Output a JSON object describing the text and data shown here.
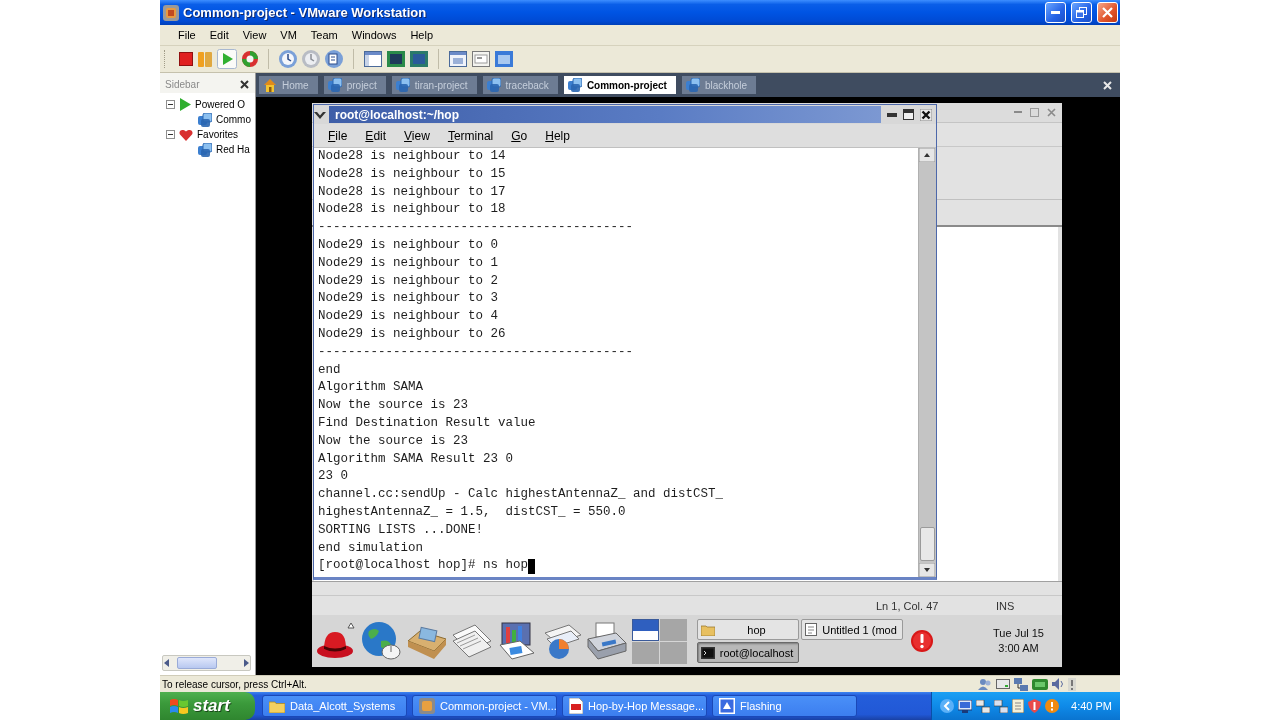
{
  "window": {
    "title": "Common-project - VMware Workstation"
  },
  "menu": [
    "File",
    "Edit",
    "View",
    "VM",
    "Team",
    "Windows",
    "Help"
  ],
  "sidebar": {
    "title": "Sidebar",
    "items": [
      {
        "label": "Powered O",
        "kind": "running",
        "expanded": true,
        "children": [
          {
            "label": "Commo",
            "kind": "vm"
          }
        ]
      },
      {
        "label": "Favorites",
        "kind": "favorites",
        "expanded": true,
        "children": [
          {
            "label": "Red Ha",
            "kind": "vm"
          }
        ]
      }
    ]
  },
  "tabs": [
    {
      "label": "Home",
      "kind": "home",
      "selected": false
    },
    {
      "label": "project",
      "kind": "vm",
      "selected": false
    },
    {
      "label": "tiran-project",
      "kind": "vm",
      "selected": false
    },
    {
      "label": "traceback",
      "kind": "vm",
      "selected": false
    },
    {
      "label": "Common-project",
      "kind": "vm",
      "selected": true
    },
    {
      "label": "blackhole",
      "kind": "vm",
      "selected": false
    }
  ],
  "guest": {
    "terminal": {
      "title": "root@localhost:~/hop",
      "menu": [
        "File",
        "Edit",
        "View",
        "Terminal",
        "Go",
        "Help"
      ],
      "lines": [
        "Node28 is neighbour to 14",
        "Node28 is neighbour to 15",
        "Node28 is neighbour to 17",
        "Node28 is neighbour to 18",
        "------------------------------------------",
        "Node29 is neighbour to 0",
        "Node29 is neighbour to 1",
        "Node29 is neighbour to 2",
        "Node29 is neighbour to 3",
        "Node29 is neighbour to 4",
        "Node29 is neighbour to 26",
        "------------------------------------------",
        "end",
        "Algorithm SAMA",
        "Now the source is 23",
        "Find Destination Result value",
        "Now the source is 23",
        "Algorithm SAMA Result 23 0",
        "23 0",
        "channel.cc:sendUp - Calc highestAntennaZ_ and distCST_",
        "highestAntennaZ_ = 1.5,  distCST_ = 550.0",
        "SORTING LISTS ...DONE!",
        "end simulation"
      ],
      "prompt": "[root@localhost hop]# ns hop"
    },
    "editor": {
      "status": [
        "Ln 1, Col. 47",
        "INS"
      ]
    },
    "panel": {
      "workspaces": [
        {
          "selected": true
        },
        {
          "selected": false
        },
        {
          "selected": false
        },
        {
          "selected": false
        }
      ],
      "tasks": [
        {
          "label": "hop",
          "kind": "folder",
          "selected": false
        },
        {
          "label": "Untitled 1 (mod",
          "kind": "editor",
          "selected": false
        },
        {
          "label": "root@localhost",
          "kind": "terminal",
          "selected": true
        }
      ],
      "clock": {
        "date": "Tue Jul 15",
        "time": "3:00 AM"
      }
    }
  },
  "status_bar": {
    "text": "To release cursor, press Ctrl+Alt."
  },
  "taskbar": {
    "start": "start",
    "tasks": [
      {
        "label": "Data_Alcott_Systems",
        "kind": "folder"
      },
      {
        "label": "Common-project - VM...",
        "kind": "vmware"
      },
      {
        "label": "Hop-by-Hop Message...",
        "kind": "pdf"
      },
      {
        "label": "Flashing",
        "kind": "app"
      }
    ],
    "clock": "4:40 PM"
  }
}
